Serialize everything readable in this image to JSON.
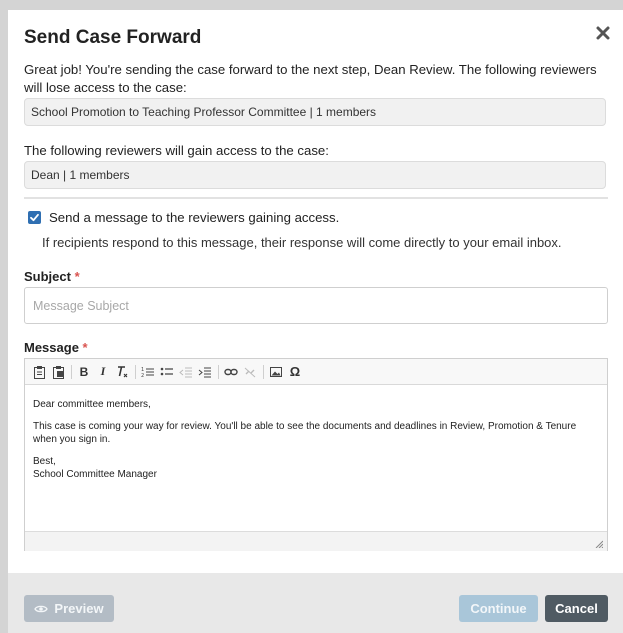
{
  "dialog": {
    "title": "Send Case Forward",
    "intro": "Great job! You're sending the case forward to the next step, Dean Review. The following reviewers will lose access to the case:",
    "lose_access_value": "School Promotion to Teaching Professor Committee | 1 members",
    "gain_access_label": "The following reviewers will gain access to the case:",
    "gain_access_value": "Dean | 1 members"
  },
  "notify": {
    "checked": true,
    "label": "Send a message to the reviewers gaining access.",
    "hint": "If recipients respond to this message, their response will come directly to your email inbox."
  },
  "subject": {
    "label": "Subject",
    "required_mark": "*",
    "placeholder": "Message Subject",
    "value": ""
  },
  "message": {
    "label": "Message",
    "required_mark": "*",
    "toolbar": [
      "paste-icon",
      "paste-from-word-icon",
      "bold-icon",
      "italic-icon",
      "remove-format-icon",
      "numbered-list-icon",
      "bulleted-list-icon",
      "decrease-indent-icon",
      "increase-indent-icon",
      "link-icon",
      "unlink-icon",
      "image-icon",
      "special-character-icon"
    ],
    "body": {
      "greeting": "Dear committee members,",
      "paragraph": "This case is coming your way for review. You'll be able to see the documents and deadlines in Review, Promotion & Tenure when you sign in.",
      "signoff": "Best,",
      "signature": "School Committee Manager"
    }
  },
  "footer": {
    "preview_label": "Preview",
    "continue_label": "Continue",
    "cancel_label": "Cancel"
  },
  "colors": {
    "accent": "#2f6fb2",
    "required": "#d9534f",
    "cancel": "#505b63",
    "continue_disabled": "#a9c6d9",
    "preview_disabled": "#b3bcc5"
  }
}
